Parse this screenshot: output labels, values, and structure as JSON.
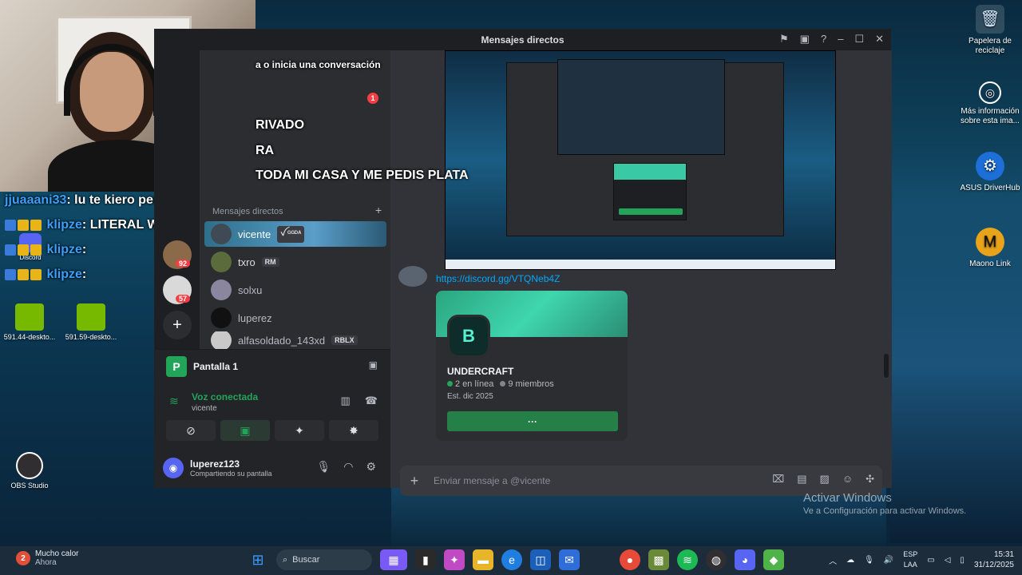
{
  "overlay": {
    "line1": "a o inicia una conversación",
    "line2": "RIVADO",
    "line3": "RA",
    "line4": "TODA MI CASA Y ME PEDIS PLATA",
    "chat": [
      {
        "user": "jjuaaani33",
        "text": ": lu te kiero perdon"
      },
      {
        "user": "klipze",
        "text": ": LITERAL WEI"
      },
      {
        "user": "klipze",
        "text": ":"
      },
      {
        "user": "klipze",
        "text": ":"
      }
    ],
    "badge_count_1": "1"
  },
  "discord": {
    "window_title": "Mensajes directos",
    "dm_section": "Mensajes directos",
    "server_badges": [
      "92",
      "57"
    ],
    "dms": [
      {
        "name": "vicente",
        "tag": "ꪜ ᴳᴳᴰᴬ"
      },
      {
        "name": "txro",
        "tag": "RM"
      },
      {
        "name": "solxu",
        "tag": ""
      },
      {
        "name": "luperez",
        "tag": ""
      },
      {
        "name": "alfasoldado_143xd",
        "tag": "RBLX"
      }
    ],
    "stream_panel": {
      "title": "Pantalla 1",
      "voice_status": "Voz conectada",
      "voice_channel": "vicente"
    },
    "user": {
      "name": "luperez123",
      "status": "Compartiendo su pantalla"
    },
    "chat": {
      "link": "https://discord.gg/VTQNeb4Z",
      "invite_name": "UNDERCRAFT",
      "online": "2 en línea",
      "members": "9 miembros",
      "established": "Est. dic 2025",
      "join_label": "···",
      "composer_placeholder": "Enviar mensaje a @vicente"
    }
  },
  "desktop": {
    "icons_right": [
      {
        "label": "Papelera de reciclaje"
      },
      {
        "label": "Más información sobre esta ima..."
      },
      {
        "label": "ASUS DriverHub"
      },
      {
        "label": "Maono Link"
      }
    ],
    "icons_left": [
      {
        "label": "591.44-deskto..."
      },
      {
        "label": "591.59-deskto..."
      },
      {
        "label": "OBS Studio"
      },
      {
        "label": "Discord"
      }
    ],
    "activate_title": "Activar Windows",
    "activate_sub": "Ve a Configuración para activar Windows."
  },
  "taskbar": {
    "weather_title": "Mucho calor",
    "weather_sub": "Ahora",
    "weather_badge": "2",
    "search_placeholder": "Buscar",
    "lang_1": "ESP",
    "lang_2": "LAA",
    "time": "15:31",
    "date": "31/12/2025"
  },
  "colors": {
    "discord_bg": "#313338",
    "accent_green": "#23a559",
    "link": "#00a8fc",
    "chat_user": "#3aa0ff"
  }
}
